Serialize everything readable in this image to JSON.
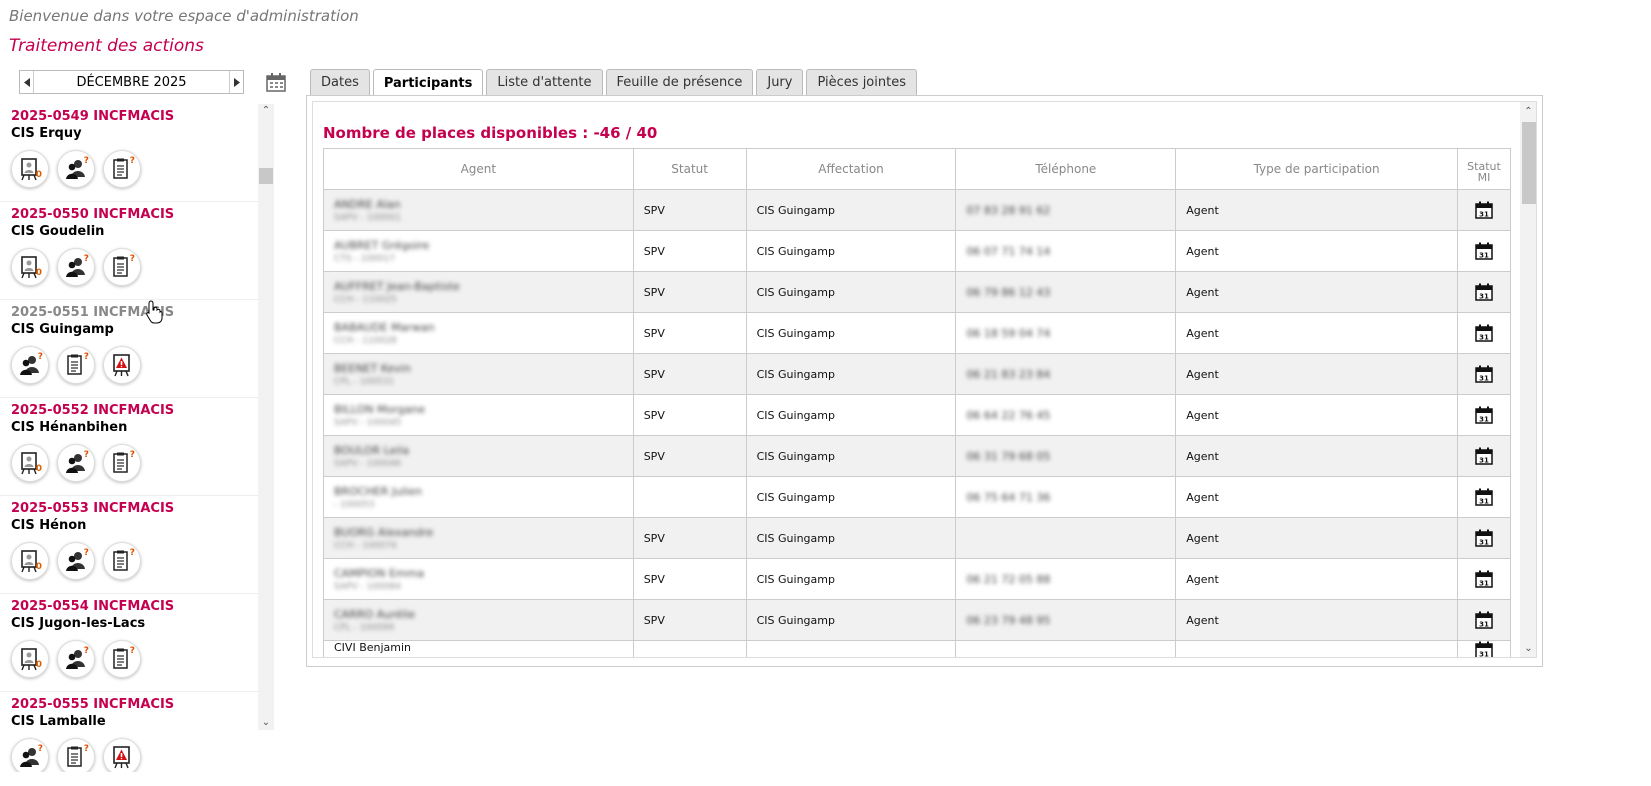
{
  "header": {
    "welcome": "Bienvenue dans votre espace d'administration",
    "section_title": "Traitement des actions"
  },
  "month_nav": {
    "label": "DÉCEMBRE 2025",
    "prev_icon": "triangle-left-icon",
    "next_icon": "triangle-right-icon",
    "calendar_icon": "calendar-icon"
  },
  "actions": [
    {
      "code": "2025-0549 INCFMACIS",
      "location": "CIS Erquy",
      "muted": false,
      "icons": [
        "trainer-board-icon",
        "users-question-icon",
        "clipboard-question-icon"
      ]
    },
    {
      "code": "2025-0550 INCFMACIS",
      "location": "CIS Goudelin",
      "muted": false,
      "icons": [
        "trainer-board-icon",
        "users-question-icon",
        "clipboard-question-icon"
      ]
    },
    {
      "code": "2025-0551 INCFMACIS",
      "location": "CIS Guingamp",
      "muted": true,
      "icons": [
        "users-question-icon",
        "clipboard-question-icon",
        "warning-board-icon"
      ]
    },
    {
      "code": "2025-0552 INCFMACIS",
      "location": "CIS Hénanbihen",
      "muted": false,
      "icons": [
        "trainer-board-icon",
        "users-question-icon",
        "clipboard-question-icon"
      ]
    },
    {
      "code": "2025-0553 INCFMACIS",
      "location": "CIS Hénon",
      "muted": false,
      "icons": [
        "trainer-board-icon",
        "users-question-icon",
        "clipboard-question-icon"
      ]
    },
    {
      "code": "2025-0554 INCFMACIS",
      "location": "CIS Jugon-les-Lacs",
      "muted": false,
      "icons": [
        "trainer-board-icon",
        "users-question-icon",
        "clipboard-question-icon"
      ]
    },
    {
      "code": "2025-0555 INCFMACIS",
      "location": "CIS Lamballe",
      "muted": false,
      "icons": [
        "users-question-icon",
        "clipboard-question-icon",
        "warning-board-icon"
      ]
    }
  ],
  "badges": {
    "zero": "0",
    "question": "?"
  },
  "tabs": [
    {
      "label": "Dates",
      "active": false
    },
    {
      "label": "Participants",
      "active": true
    },
    {
      "label": "Liste d'attente",
      "active": false
    },
    {
      "label": "Feuille de présence",
      "active": false
    },
    {
      "label": "Jury",
      "active": false
    },
    {
      "label": "Pièces jointes",
      "active": false
    }
  ],
  "participants": {
    "places_text": "Nombre de places disponibles : -46 / 40",
    "columns": [
      "Agent",
      "Statut",
      "Affectation",
      "Téléphone",
      "Type de participation",
      "Statut MI"
    ],
    "rows": [
      {
        "agent": "ANDRE Alan",
        "agent_sub": "SAPV - 100001",
        "statut": "SPV",
        "affectation": "CIS Guingamp",
        "telephone": "07 83 28 91 62",
        "type": "Agent"
      },
      {
        "agent": "AUBRET Grégoire",
        "agent_sub": "CTS - 100017",
        "statut": "SPV",
        "affectation": "CIS Guingamp",
        "telephone": "06 07 71 74 14",
        "type": "Agent"
      },
      {
        "agent": "AUFFRET Jean-Baptiste",
        "agent_sub": "CCH - 110025",
        "statut": "SPV",
        "affectation": "CIS Guingamp",
        "telephone": "06 79 86 12 43",
        "type": "Agent"
      },
      {
        "agent": "BABAUDE Marwan",
        "agent_sub": "CCH - 110028",
        "statut": "SPV",
        "affectation": "CIS Guingamp",
        "telephone": "06 18 59 04 74",
        "type": "Agent"
      },
      {
        "agent": "BEENET Kevin",
        "agent_sub": "CPL - 100531",
        "statut": "SPV",
        "affectation": "CIS Guingamp",
        "telephone": "06 21 83 23 84",
        "type": "Agent"
      },
      {
        "agent": "BILLON Morgane",
        "agent_sub": "SAPV - 100045",
        "statut": "SPV",
        "affectation": "CIS Guingamp",
        "telephone": "06 64 22 76 45",
        "type": "Agent"
      },
      {
        "agent": "BOULOR Leila",
        "agent_sub": "SAPV - 100046",
        "statut": "SPV",
        "affectation": "CIS Guingamp",
        "telephone": "06 31 79 68 05",
        "type": "Agent"
      },
      {
        "agent": "BROCHER Julien",
        "agent_sub": "- 100053",
        "statut": "",
        "affectation": "CIS Guingamp",
        "telephone": "06 75 64 71 36",
        "type": "Agent"
      },
      {
        "agent": "BUORG Alexandre",
        "agent_sub": "CCH - 100074",
        "statut": "SPV",
        "affectation": "CIS Guingamp",
        "telephone": "",
        "type": "Agent"
      },
      {
        "agent": "CAMPION Emma",
        "agent_sub": "SAPV - 100084",
        "statut": "SPV",
        "affectation": "CIS Guingamp",
        "telephone": "06 21 72 05 88",
        "type": "Agent"
      },
      {
        "agent": "CARRO Aurélie",
        "agent_sub": "CPL - 100099",
        "statut": "SPV",
        "affectation": "CIS Guingamp",
        "telephone": "06 23 79 48 95",
        "type": "Agent"
      },
      {
        "agent": "CIVI Benjamin",
        "agent_sub": "",
        "statut": "",
        "affectation": "",
        "telephone": "",
        "type": ""
      }
    ],
    "mi_icon": "calendar-31-icon",
    "mi_icon_text": "31"
  }
}
